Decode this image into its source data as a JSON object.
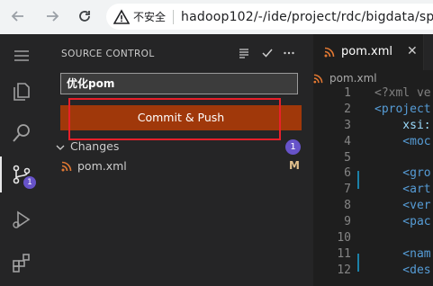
{
  "browser": {
    "security_label": "不安全",
    "url": "hadoop102/-/ide/project/rdc/bigdata/spr"
  },
  "activity_bar": {
    "scm_badge": "1",
    "icons": [
      "explorer-icon",
      "search-icon",
      "source-control-icon",
      "run-debug-icon",
      "extensions-icon"
    ]
  },
  "sidebar": {
    "title": "SOURCE CONTROL",
    "commit_message": "优化pom",
    "commit_button": "Commit & Push",
    "changes_label": "Changes",
    "changes_count": "1",
    "files": [
      {
        "name": "pom.xml",
        "status": "M"
      }
    ]
  },
  "editor": {
    "tab_label": "pom.xml",
    "breadcrumb": "pom.xml",
    "lines": [
      {
        "num": "1",
        "text": "<?xml ve"
      },
      {
        "num": "2",
        "text": "<project"
      },
      {
        "num": "3",
        "text": "    xsi:"
      },
      {
        "num": "4",
        "text": "    <moc"
      },
      {
        "num": "5",
        "text": ""
      },
      {
        "num": "6",
        "text": "    <gro"
      },
      {
        "num": "7",
        "text": "    <art"
      },
      {
        "num": "8",
        "text": "    <ver"
      },
      {
        "num": "9",
        "text": "    <pac"
      },
      {
        "num": "10",
        "text": ""
      },
      {
        "num": "11",
        "text": "    <nam"
      },
      {
        "num": "12",
        "text": "    <des"
      }
    ]
  },
  "colors": {
    "commit_button": "#a0380a",
    "badge": "#6753c9",
    "highlight_box": "#e8202a",
    "modified": "#e2c08d"
  }
}
